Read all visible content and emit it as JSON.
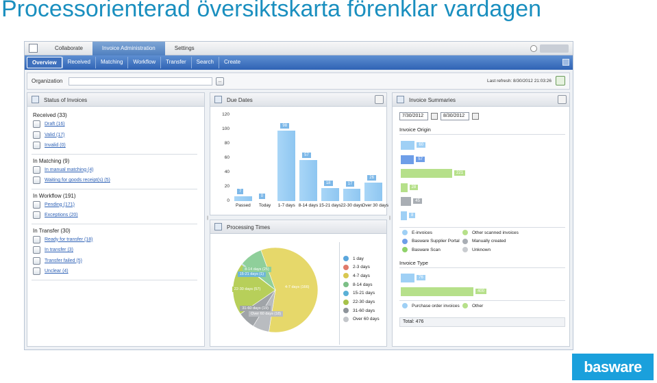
{
  "slide": {
    "title": "Processorienterad översiktskarta förenklar vardagen"
  },
  "brand": {
    "logo_text": "basware",
    "accent": "#1aa0dc"
  },
  "topbar": {
    "tabs": [
      {
        "label": "Collaborate",
        "active": false
      },
      {
        "label": "Invoice Administration",
        "active": true
      },
      {
        "label": "Settings",
        "active": false
      }
    ]
  },
  "subnav": {
    "items": [
      "Overview",
      "Received",
      "Matching",
      "Workflow",
      "Transfer",
      "Search",
      "Create"
    ],
    "active": "Overview"
  },
  "org": {
    "label": "Organization",
    "value": "",
    "browse_label": "...",
    "last_refresh": "Last refresh: 8/30/2012 21:03:26"
  },
  "status_panel": {
    "title": "Status of Invoices",
    "sections": [
      {
        "heading": "Received (33)",
        "items": [
          "Draft (16)",
          "Valid (17)",
          "Invalid (0)"
        ]
      },
      {
        "heading": "In Matching (9)",
        "items": [
          "In manual matching (4)",
          "Waiting for goods receipt(s) (5)"
        ]
      },
      {
        "heading": "In Workflow (191)",
        "items": [
          "Pending (171)",
          "Exceptions (20)"
        ]
      },
      {
        "heading": "In Transfer (30)",
        "items": [
          "Ready for transfer (18)",
          "In transfer (3)",
          "Transfer failed (5)",
          "Unclear (4)"
        ]
      }
    ]
  },
  "due_panel": {
    "title": "Due Dates",
    "chart_data": {
      "type": "bar",
      "categories": [
        "Passed",
        "Today",
        "1-7 days",
        "8-14 days",
        "15-21 days",
        "22-30 days",
        "Over 30 days"
      ],
      "values": [
        7,
        0,
        98,
        57,
        18,
        17,
        26
      ],
      "ylim": [
        0,
        120
      ],
      "yticks": [
        0,
        20,
        40,
        60,
        80,
        100,
        120
      ],
      "color": "#9fd0f5"
    }
  },
  "processing_panel": {
    "title": "Processing Times",
    "chart_data": {
      "type": "pie",
      "slices": [
        {
          "label": "4-7 days",
          "value": 166,
          "color": "#e6d86a"
        },
        {
          "label": "Over 60 days",
          "value": 18,
          "color": "#b9bcc0"
        },
        {
          "label": "31-60 days",
          "value": 19,
          "color": "#a0a4a8"
        },
        {
          "label": "22-30 days",
          "value": 57,
          "color": "#b7cf5a"
        },
        {
          "label": "15-21 days",
          "value": 1,
          "color": "#6eb6d8"
        },
        {
          "label": "8-14 days",
          "value": 25,
          "color": "#8fcf9a"
        }
      ],
      "slice_labels": {
        "4-7 days": "4-7 days (166)",
        "Over 60 days": "Over 60 days (18)",
        "31-60 days": "31-60 days (19)",
        "22-30 days": "22-30 days (57)",
        "15-21 days": "15-21 days (1)",
        "8-14 days": "8-14 days (25)"
      },
      "legend": [
        {
          "label": "1 day",
          "color": "#5aa6dc"
        },
        {
          "label": "2-3 days",
          "color": "#e07a6a"
        },
        {
          "label": "4-7 days",
          "color": "#d8c850"
        },
        {
          "label": "8-14 days",
          "color": "#7cbf86"
        },
        {
          "label": "15-21 days",
          "color": "#5ab0d6"
        },
        {
          "label": "22-30 days",
          "color": "#a6c24a"
        },
        {
          "label": "31-60 days",
          "color": "#8e949a"
        },
        {
          "label": "Over 60 days",
          "color": "#c3c6ca"
        }
      ]
    }
  },
  "summary_panel": {
    "title": "Invoice Summaries",
    "date_from": "7/30/2012",
    "date_to": "8/30/2012",
    "origin": {
      "heading": "Invoice Origin",
      "chart_data": {
        "type": "bar",
        "orientation": "horizontal",
        "values": [
          60,
          57,
          221,
          28,
          45,
          8
        ],
        "colors": [
          "#9fd0f5",
          "#6e9ee8",
          "#b6e08a",
          "#b6e08a",
          "#a9aeb4",
          "#9fd0f5"
        ]
      },
      "legend": [
        {
          "label": "E-invoices",
          "color": "#9fd0f5"
        },
        {
          "label": "Other scanned invoices",
          "color": "#b6e08a"
        },
        {
          "label": "Basware Supplier Portal",
          "color": "#6e9ee8"
        },
        {
          "label": "Manually created",
          "color": "#a9aeb4"
        },
        {
          "label": "Basware Scan",
          "color": "#8fd26a"
        },
        {
          "label": "Unknown",
          "color": "#c9ccd0"
        }
      ]
    },
    "type_section": {
      "heading": "Invoice Type",
      "chart_data": {
        "type": "bar",
        "orientation": "horizontal",
        "values": [
          76,
          400
        ],
        "colors": [
          "#9fd0f5",
          "#b6e08a"
        ]
      },
      "legend": [
        {
          "label": "Purchase order invoices",
          "color": "#9fd0f5"
        },
        {
          "label": "Other",
          "color": "#b6e08a"
        }
      ]
    },
    "total": "Total:  476"
  }
}
